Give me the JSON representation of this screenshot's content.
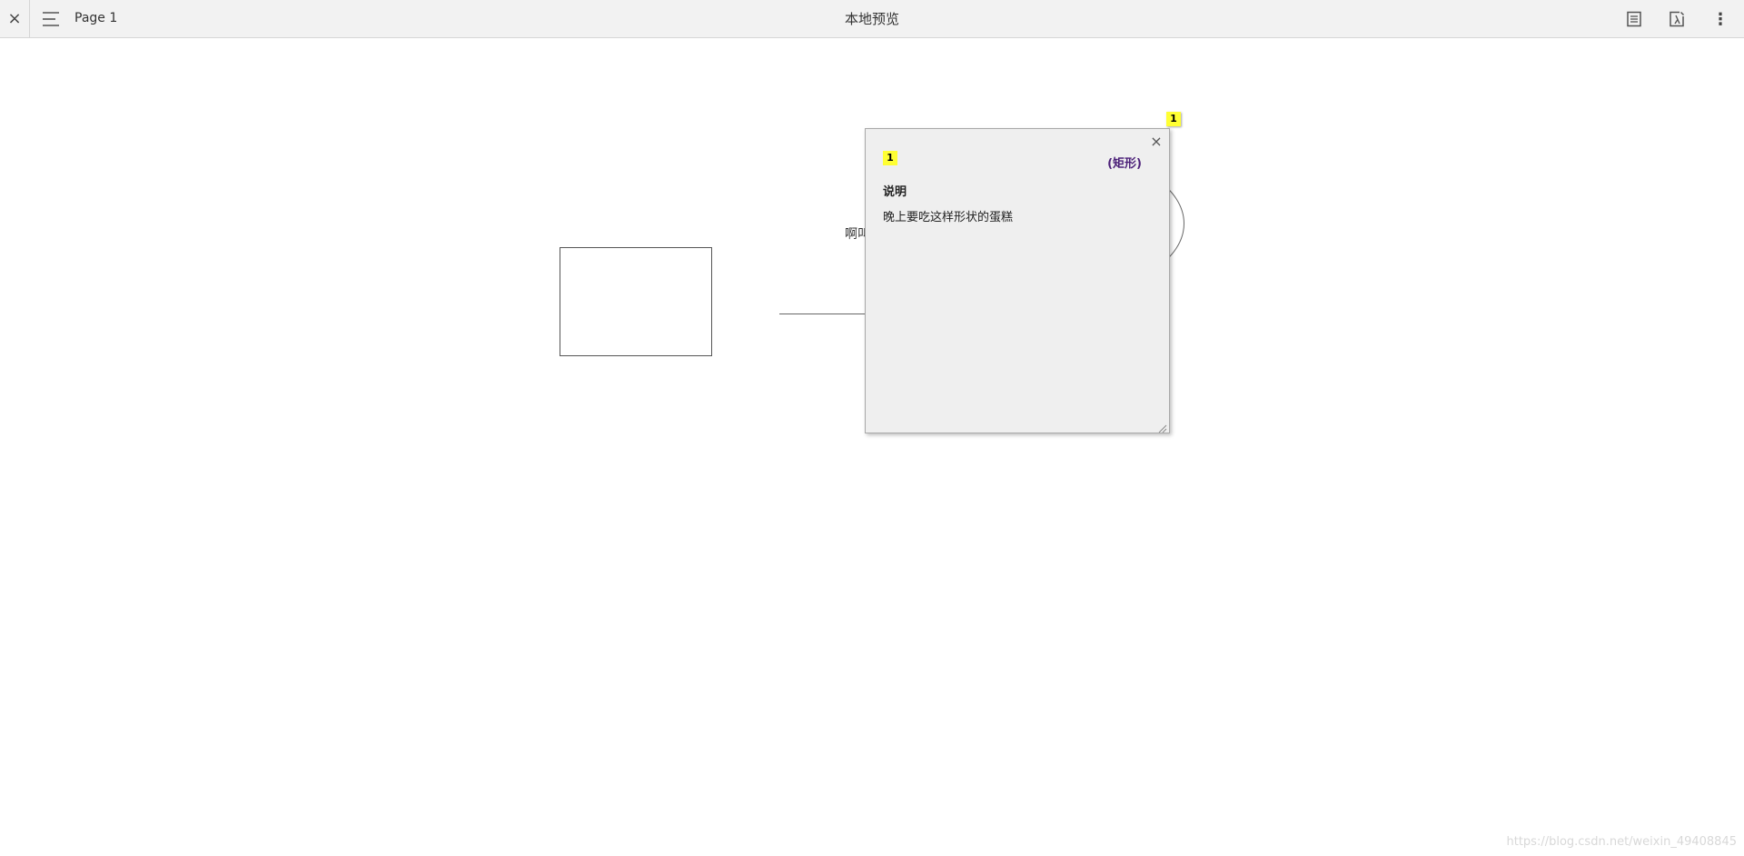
{
  "toolbar": {
    "close_glyph": "×",
    "page_label": "Page 1",
    "title": "本地预览",
    "more_glyph": "⋮"
  },
  "document": {
    "partial_text": "啊叫",
    "marker_number": "1"
  },
  "note": {
    "number": "1",
    "type_label": "(矩形)",
    "label": "说明",
    "content": "晚上要吃这样形状的蛋糕",
    "close_glyph": "×"
  },
  "watermark": "https://blog.csdn.net/weixin_49408845"
}
